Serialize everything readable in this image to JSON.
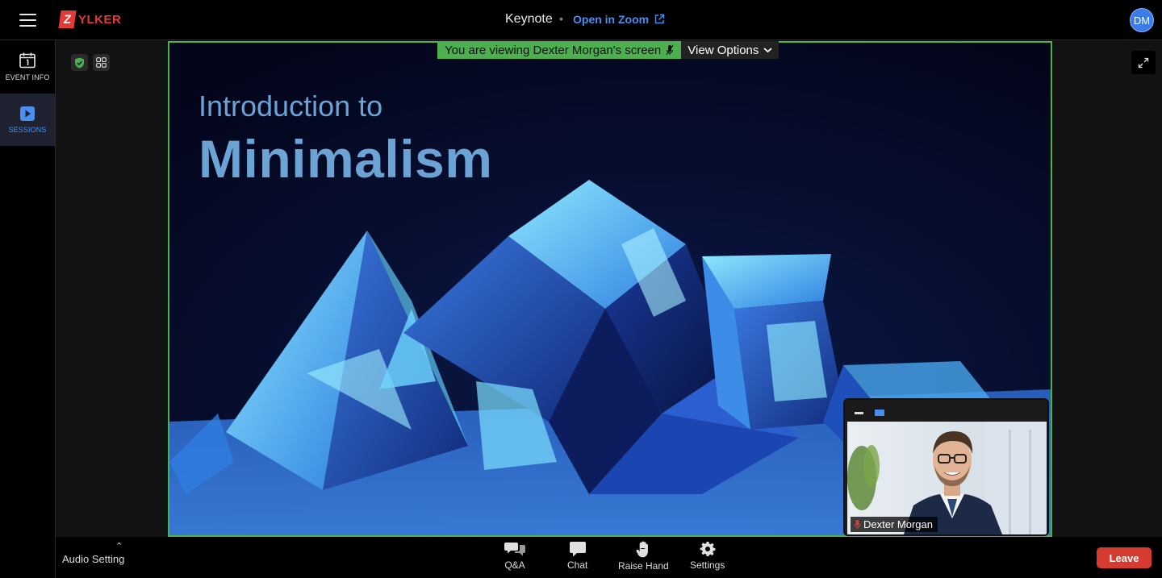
{
  "topbar": {
    "logo_initial": "Z",
    "logo_text": "YLKER",
    "session_title": "Keynote",
    "separator": "•",
    "open_zoom_label": "Open in Zoom",
    "avatar_initials": "DM"
  },
  "sidebar": {
    "items": [
      {
        "label": "EVENT INFO",
        "icon": "calendar-icon",
        "active": false
      },
      {
        "label": "SESSIONS",
        "icon": "play-icon",
        "active": true
      }
    ]
  },
  "share": {
    "banner_text": "You are viewing Dexter Morgan's screen",
    "view_options_label": "View Options",
    "slide_subtitle": "Introduction to",
    "slide_title": "Minimalism"
  },
  "self_view": {
    "name": "Dexter Morgan",
    "muted": true
  },
  "bottombar": {
    "audio_setting_label": "Audio Setting",
    "controls": [
      {
        "label": "Q&A",
        "icon": "qa-icon"
      },
      {
        "label": "Chat",
        "icon": "chat-icon"
      },
      {
        "label": "Raise Hand",
        "icon": "hand-icon"
      },
      {
        "label": "Settings",
        "icon": "gear-icon"
      }
    ],
    "leave_label": "Leave"
  },
  "colors": {
    "accent": "#4a8ef0",
    "share_border": "#4caf50",
    "leave": "#d63b32",
    "brand": "#e53935"
  }
}
